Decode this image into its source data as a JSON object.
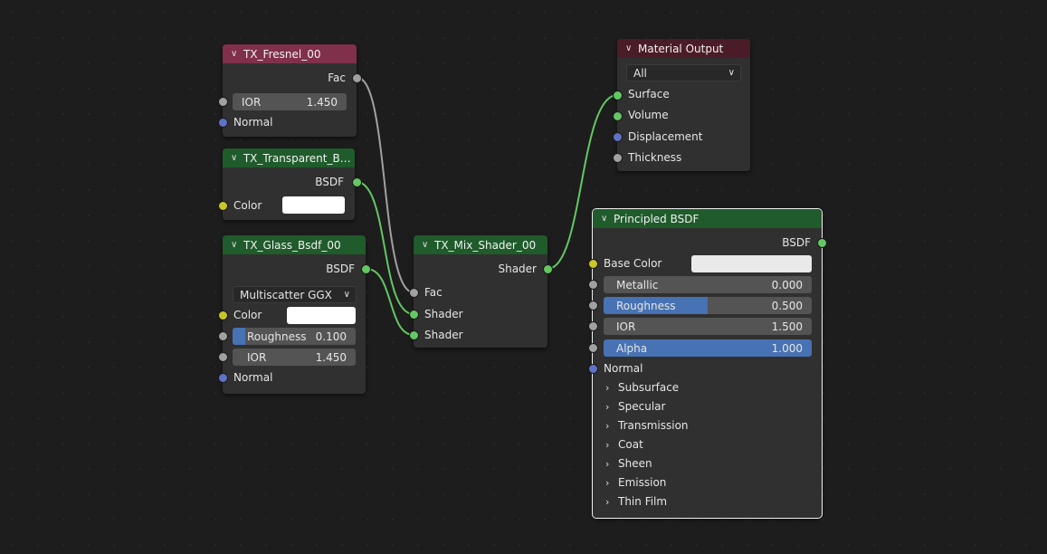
{
  "nodes": {
    "fresnel": {
      "title": "TX_Fresnel_00",
      "output": "Fac",
      "ior_label": "IOR",
      "ior_value": "1.450",
      "normal": "Normal"
    },
    "transparent": {
      "title": "TX_Transparent_Bs...",
      "output": "BSDF",
      "color_label": "Color"
    },
    "glass": {
      "title": "TX_Glass_Bsdf_00",
      "output": "BSDF",
      "distribution": "Multiscatter GGX",
      "color_label": "Color",
      "roughness_label": "Roughness",
      "roughness_value": "0.100",
      "roughness_fraction": 0.1,
      "ior_label": "IOR",
      "ior_value": "1.450",
      "normal": "Normal"
    },
    "mix": {
      "title": "TX_Mix_Shader_00",
      "output": "Shader",
      "inputs": [
        "Fac",
        "Shader",
        "Shader"
      ]
    },
    "output": {
      "title": "Material Output",
      "target": "All",
      "inputs": [
        "Surface",
        "Volume",
        "Displacement",
        "Thickness"
      ]
    },
    "principled": {
      "title": "Principled BSDF",
      "output": "BSDF",
      "base_color_label": "Base Color",
      "metallic_label": "Metallic",
      "metallic_value": "0.000",
      "roughness_label": "Roughness",
      "roughness_value": "0.500",
      "roughness_fraction": 0.5,
      "ior_label": "IOR",
      "ior_value": "1.500",
      "alpha_label": "Alpha",
      "alpha_value": "1.000",
      "normal": "Normal",
      "panels": [
        "Subsurface",
        "Specular",
        "Transmission",
        "Coat",
        "Sheen",
        "Emission",
        "Thin Film"
      ]
    }
  },
  "icons": {
    "collapse": "chevron-down-icon",
    "panel": "chevron-right-icon",
    "dropdown": "chevron-down-icon"
  },
  "colors": {
    "texture_header": "#80304a",
    "shader_header": "#1f5b2b",
    "output_header": "#4a1c27",
    "link": "#a1a1a1",
    "shader_link": "#63c763",
    "slider_blue": "#4772b3"
  }
}
